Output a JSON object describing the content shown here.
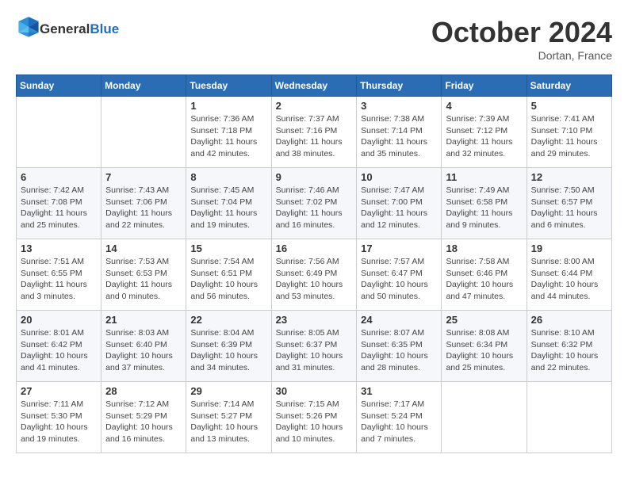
{
  "header": {
    "logo_general": "General",
    "logo_blue": "Blue",
    "month_title": "October 2024",
    "location": "Dortan, France"
  },
  "weekdays": [
    "Sunday",
    "Monday",
    "Tuesday",
    "Wednesday",
    "Thursday",
    "Friday",
    "Saturday"
  ],
  "weeks": [
    [
      {
        "day": "",
        "info": ""
      },
      {
        "day": "",
        "info": ""
      },
      {
        "day": "1",
        "info": "Sunrise: 7:36 AM\nSunset: 7:18 PM\nDaylight: 11 hours and 42 minutes."
      },
      {
        "day": "2",
        "info": "Sunrise: 7:37 AM\nSunset: 7:16 PM\nDaylight: 11 hours and 38 minutes."
      },
      {
        "day": "3",
        "info": "Sunrise: 7:38 AM\nSunset: 7:14 PM\nDaylight: 11 hours and 35 minutes."
      },
      {
        "day": "4",
        "info": "Sunrise: 7:39 AM\nSunset: 7:12 PM\nDaylight: 11 hours and 32 minutes."
      },
      {
        "day": "5",
        "info": "Sunrise: 7:41 AM\nSunset: 7:10 PM\nDaylight: 11 hours and 29 minutes."
      }
    ],
    [
      {
        "day": "6",
        "info": "Sunrise: 7:42 AM\nSunset: 7:08 PM\nDaylight: 11 hours and 25 minutes."
      },
      {
        "day": "7",
        "info": "Sunrise: 7:43 AM\nSunset: 7:06 PM\nDaylight: 11 hours and 22 minutes."
      },
      {
        "day": "8",
        "info": "Sunrise: 7:45 AM\nSunset: 7:04 PM\nDaylight: 11 hours and 19 minutes."
      },
      {
        "day": "9",
        "info": "Sunrise: 7:46 AM\nSunset: 7:02 PM\nDaylight: 11 hours and 16 minutes."
      },
      {
        "day": "10",
        "info": "Sunrise: 7:47 AM\nSunset: 7:00 PM\nDaylight: 11 hours and 12 minutes."
      },
      {
        "day": "11",
        "info": "Sunrise: 7:49 AM\nSunset: 6:58 PM\nDaylight: 11 hours and 9 minutes."
      },
      {
        "day": "12",
        "info": "Sunrise: 7:50 AM\nSunset: 6:57 PM\nDaylight: 11 hours and 6 minutes."
      }
    ],
    [
      {
        "day": "13",
        "info": "Sunrise: 7:51 AM\nSunset: 6:55 PM\nDaylight: 11 hours and 3 minutes."
      },
      {
        "day": "14",
        "info": "Sunrise: 7:53 AM\nSunset: 6:53 PM\nDaylight: 11 hours and 0 minutes."
      },
      {
        "day": "15",
        "info": "Sunrise: 7:54 AM\nSunset: 6:51 PM\nDaylight: 10 hours and 56 minutes."
      },
      {
        "day": "16",
        "info": "Sunrise: 7:56 AM\nSunset: 6:49 PM\nDaylight: 10 hours and 53 minutes."
      },
      {
        "day": "17",
        "info": "Sunrise: 7:57 AM\nSunset: 6:47 PM\nDaylight: 10 hours and 50 minutes."
      },
      {
        "day": "18",
        "info": "Sunrise: 7:58 AM\nSunset: 6:46 PM\nDaylight: 10 hours and 47 minutes."
      },
      {
        "day": "19",
        "info": "Sunrise: 8:00 AM\nSunset: 6:44 PM\nDaylight: 10 hours and 44 minutes."
      }
    ],
    [
      {
        "day": "20",
        "info": "Sunrise: 8:01 AM\nSunset: 6:42 PM\nDaylight: 10 hours and 41 minutes."
      },
      {
        "day": "21",
        "info": "Sunrise: 8:03 AM\nSunset: 6:40 PM\nDaylight: 10 hours and 37 minutes."
      },
      {
        "day": "22",
        "info": "Sunrise: 8:04 AM\nSunset: 6:39 PM\nDaylight: 10 hours and 34 minutes."
      },
      {
        "day": "23",
        "info": "Sunrise: 8:05 AM\nSunset: 6:37 PM\nDaylight: 10 hours and 31 minutes."
      },
      {
        "day": "24",
        "info": "Sunrise: 8:07 AM\nSunset: 6:35 PM\nDaylight: 10 hours and 28 minutes."
      },
      {
        "day": "25",
        "info": "Sunrise: 8:08 AM\nSunset: 6:34 PM\nDaylight: 10 hours and 25 minutes."
      },
      {
        "day": "26",
        "info": "Sunrise: 8:10 AM\nSunset: 6:32 PM\nDaylight: 10 hours and 22 minutes."
      }
    ],
    [
      {
        "day": "27",
        "info": "Sunrise: 7:11 AM\nSunset: 5:30 PM\nDaylight: 10 hours and 19 minutes."
      },
      {
        "day": "28",
        "info": "Sunrise: 7:12 AM\nSunset: 5:29 PM\nDaylight: 10 hours and 16 minutes."
      },
      {
        "day": "29",
        "info": "Sunrise: 7:14 AM\nSunset: 5:27 PM\nDaylight: 10 hours and 13 minutes."
      },
      {
        "day": "30",
        "info": "Sunrise: 7:15 AM\nSunset: 5:26 PM\nDaylight: 10 hours and 10 minutes."
      },
      {
        "day": "31",
        "info": "Sunrise: 7:17 AM\nSunset: 5:24 PM\nDaylight: 10 hours and 7 minutes."
      },
      {
        "day": "",
        "info": ""
      },
      {
        "day": "",
        "info": ""
      }
    ]
  ]
}
